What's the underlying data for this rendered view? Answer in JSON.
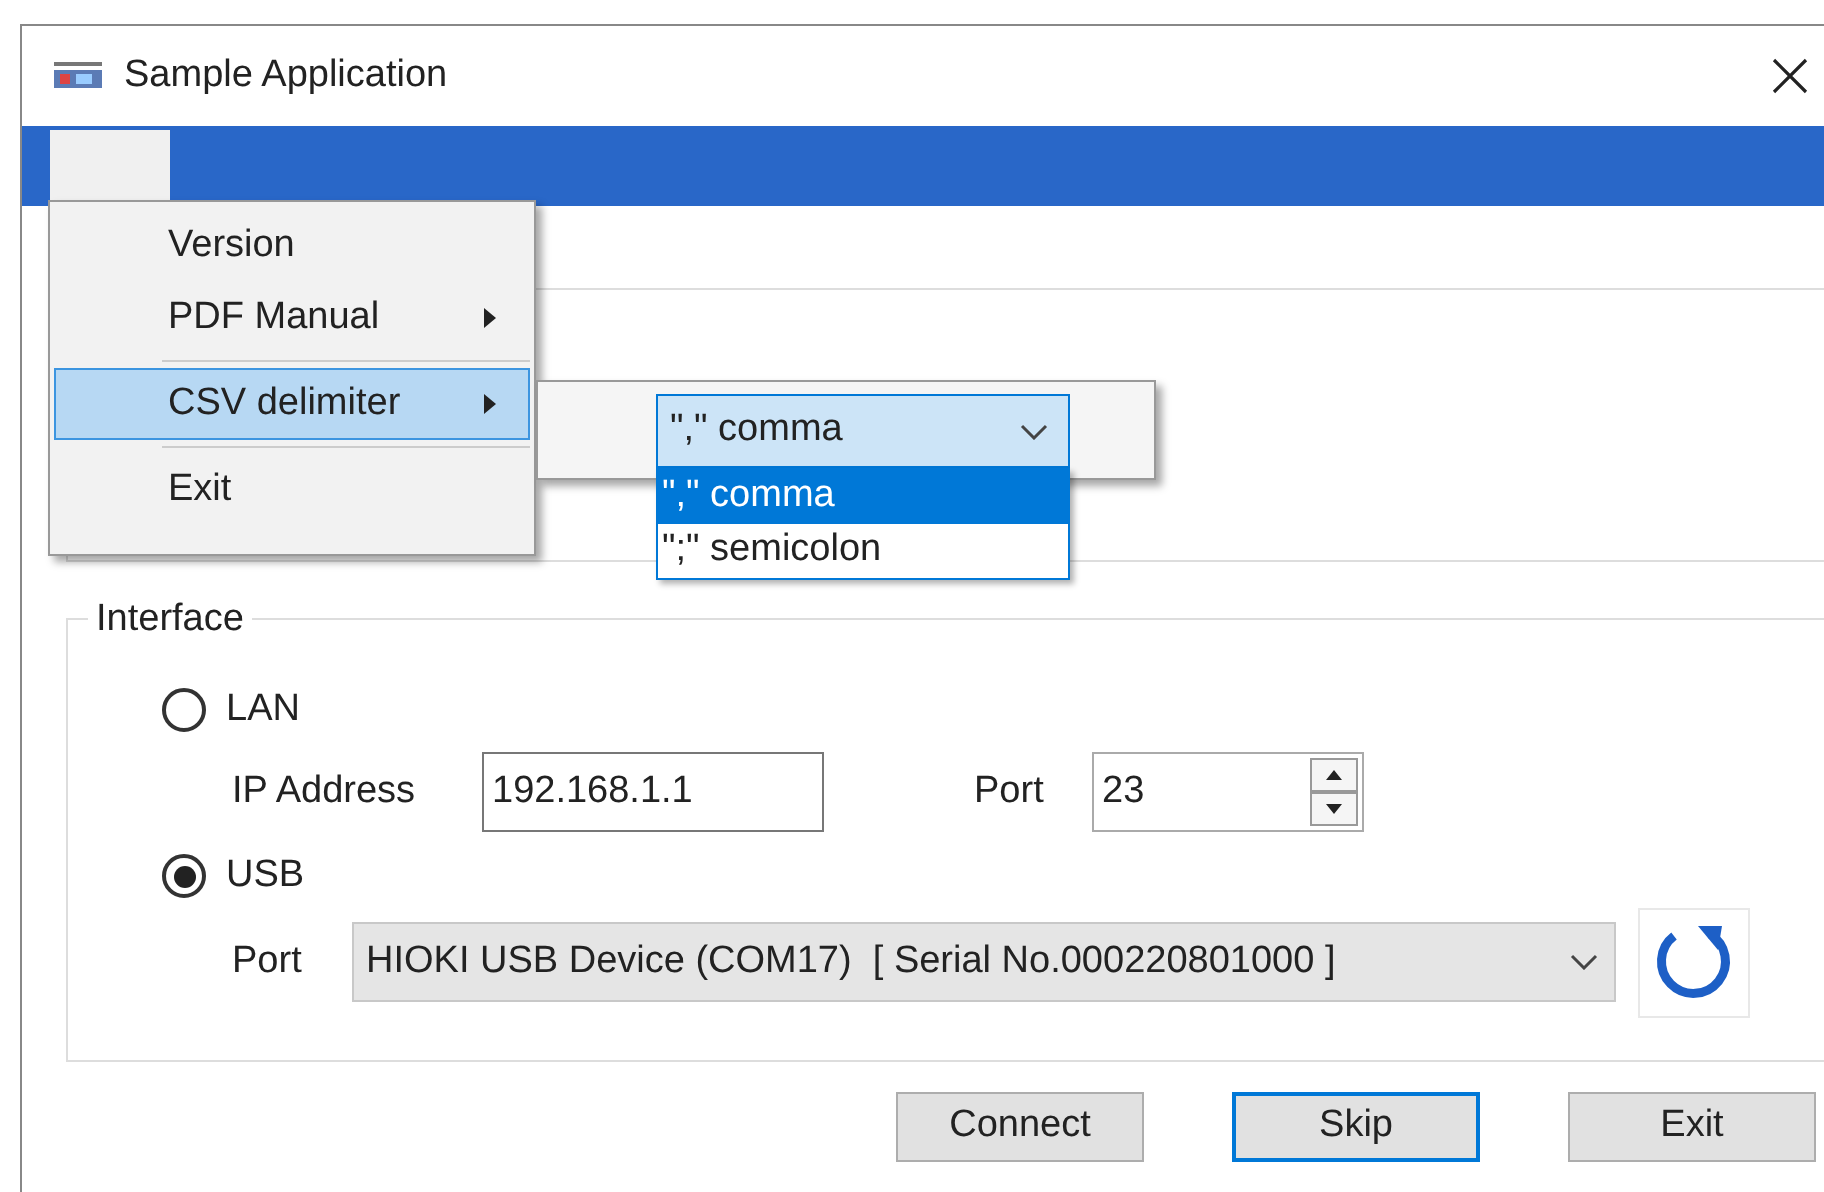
{
  "window": {
    "title": "Sample Application"
  },
  "menu": {
    "items": [
      {
        "kind": "item",
        "label": "Version",
        "submenu": false,
        "selected": false
      },
      {
        "kind": "item",
        "label": "PDF Manual",
        "submenu": true,
        "selected": false
      },
      {
        "kind": "separator"
      },
      {
        "kind": "item",
        "label": "CSV delimiter",
        "submenu": true,
        "selected": true
      },
      {
        "kind": "separator"
      },
      {
        "kind": "item",
        "label": "Exit",
        "submenu": false,
        "selected": false
      }
    ]
  },
  "csv_submenu": {
    "combo_value": "\",\" comma",
    "options": [
      {
        "label": "\",\" comma",
        "selected": true
      },
      {
        "label": "\";\" semicolon",
        "selected": false
      }
    ]
  },
  "interface": {
    "title": "Interface",
    "connections": [
      {
        "label": "LAN",
        "selected": false
      },
      {
        "label": "USB",
        "selected": true
      }
    ],
    "ip_label": "IP Address",
    "ip_value": "192.168.1.1",
    "lan_port_label": "Port",
    "lan_port_value": "23",
    "usb_port_label": "Port",
    "usb_port_value": "HIOKI USB Device (COM17)  [ Serial No.000220801000 ]"
  },
  "buttons": [
    {
      "label": "Connect",
      "default": false
    },
    {
      "label": "Skip",
      "default": true
    },
    {
      "label": "Exit",
      "default": false
    }
  ]
}
